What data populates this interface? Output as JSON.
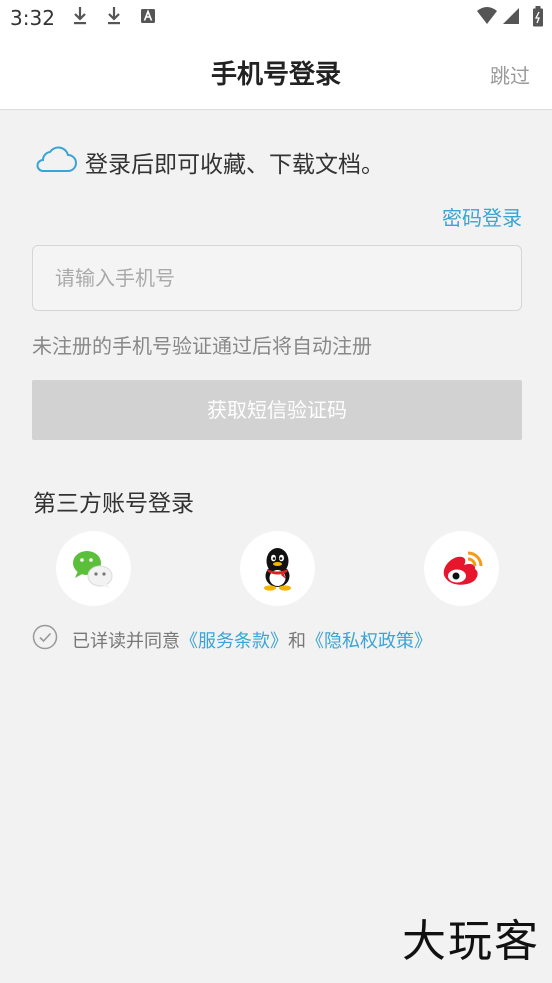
{
  "status_bar": {
    "time": "3:32"
  },
  "header": {
    "title": "手机号登录",
    "skip_label": "跳过"
  },
  "notice": {
    "text": "登录后即可收藏、下载文档。"
  },
  "password_login_label": "密码登录",
  "phone_input": {
    "placeholder": "请输入手机号",
    "value": ""
  },
  "hint": "未注册的手机号验证通过后将自动注册",
  "sms_button_label": "获取短信验证码",
  "third_party": {
    "title": "第三方账号登录",
    "providers": [
      "wechat",
      "qq",
      "weibo"
    ]
  },
  "agreement": {
    "prefix": "已详读并同意",
    "terms_link": "《服务条款》",
    "and": "和",
    "privacy_link": "《隐私权政策》",
    "checked": false
  },
  "watermark": "大玩客",
  "colors": {
    "accent": "#3aa4d6",
    "button_disabled": "#d2d2d2",
    "background": "#f2f2f2"
  }
}
